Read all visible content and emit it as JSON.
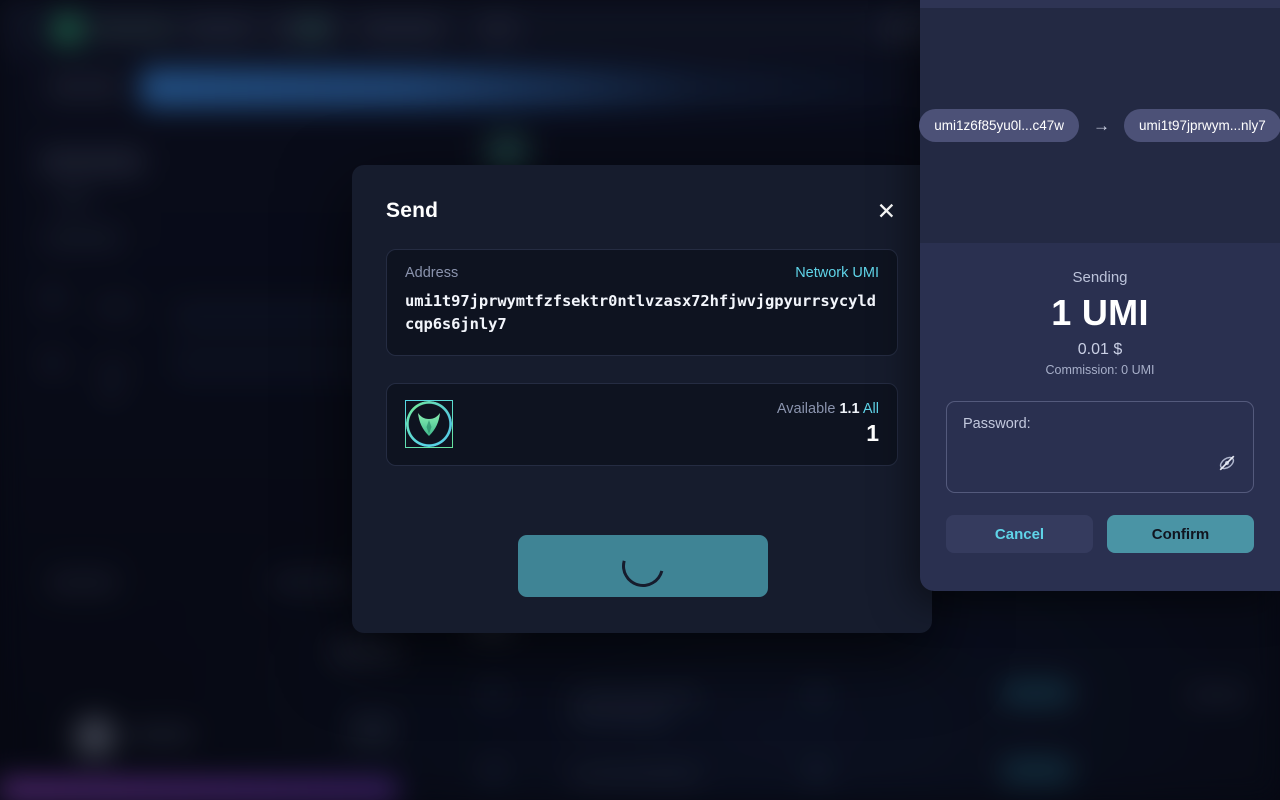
{
  "modal": {
    "title": "Send",
    "close_icon": "close-icon",
    "address_field": {
      "label": "Address",
      "network_label": "Network UMI",
      "value": "umi1t97jprwymtfzfsektr0ntlvzasx72hfjwvjgpyurrsycyldcqp6s6jnly7"
    },
    "amount_field": {
      "coin_icon": "umi-coin-icon",
      "available_label": "Available",
      "available_value": "1.1",
      "all_label": "All",
      "amount_value": "1"
    },
    "submit_button": {
      "state": "loading",
      "icon": "loading-spinner-icon",
      "label": ""
    }
  },
  "panel": {
    "from_chip": "umi1z6f85yu0l...c47w",
    "arrow_icon": "arrow-right-icon",
    "to_chip": "umi1t97jprwym...nly7",
    "sending_label": "Sending",
    "sending_amount": "1 UMI",
    "sending_fiat": "0.01 $",
    "commission": "Commission: 0 UMI",
    "password": {
      "label": "Password:",
      "value": "",
      "toggle_icon": "eye-off-icon"
    },
    "cancel_label": "Cancel",
    "confirm_label": "Confirm"
  },
  "colors": {
    "accent_cyan": "#5fd4e8",
    "accent_teal": "#4a94a5",
    "modal_bg": "#161c2d",
    "card_bg": "#0e1320",
    "panel_bg": "#2a3050",
    "chip_bg": "#4c5177",
    "coin_green": "#6fe6a2"
  }
}
